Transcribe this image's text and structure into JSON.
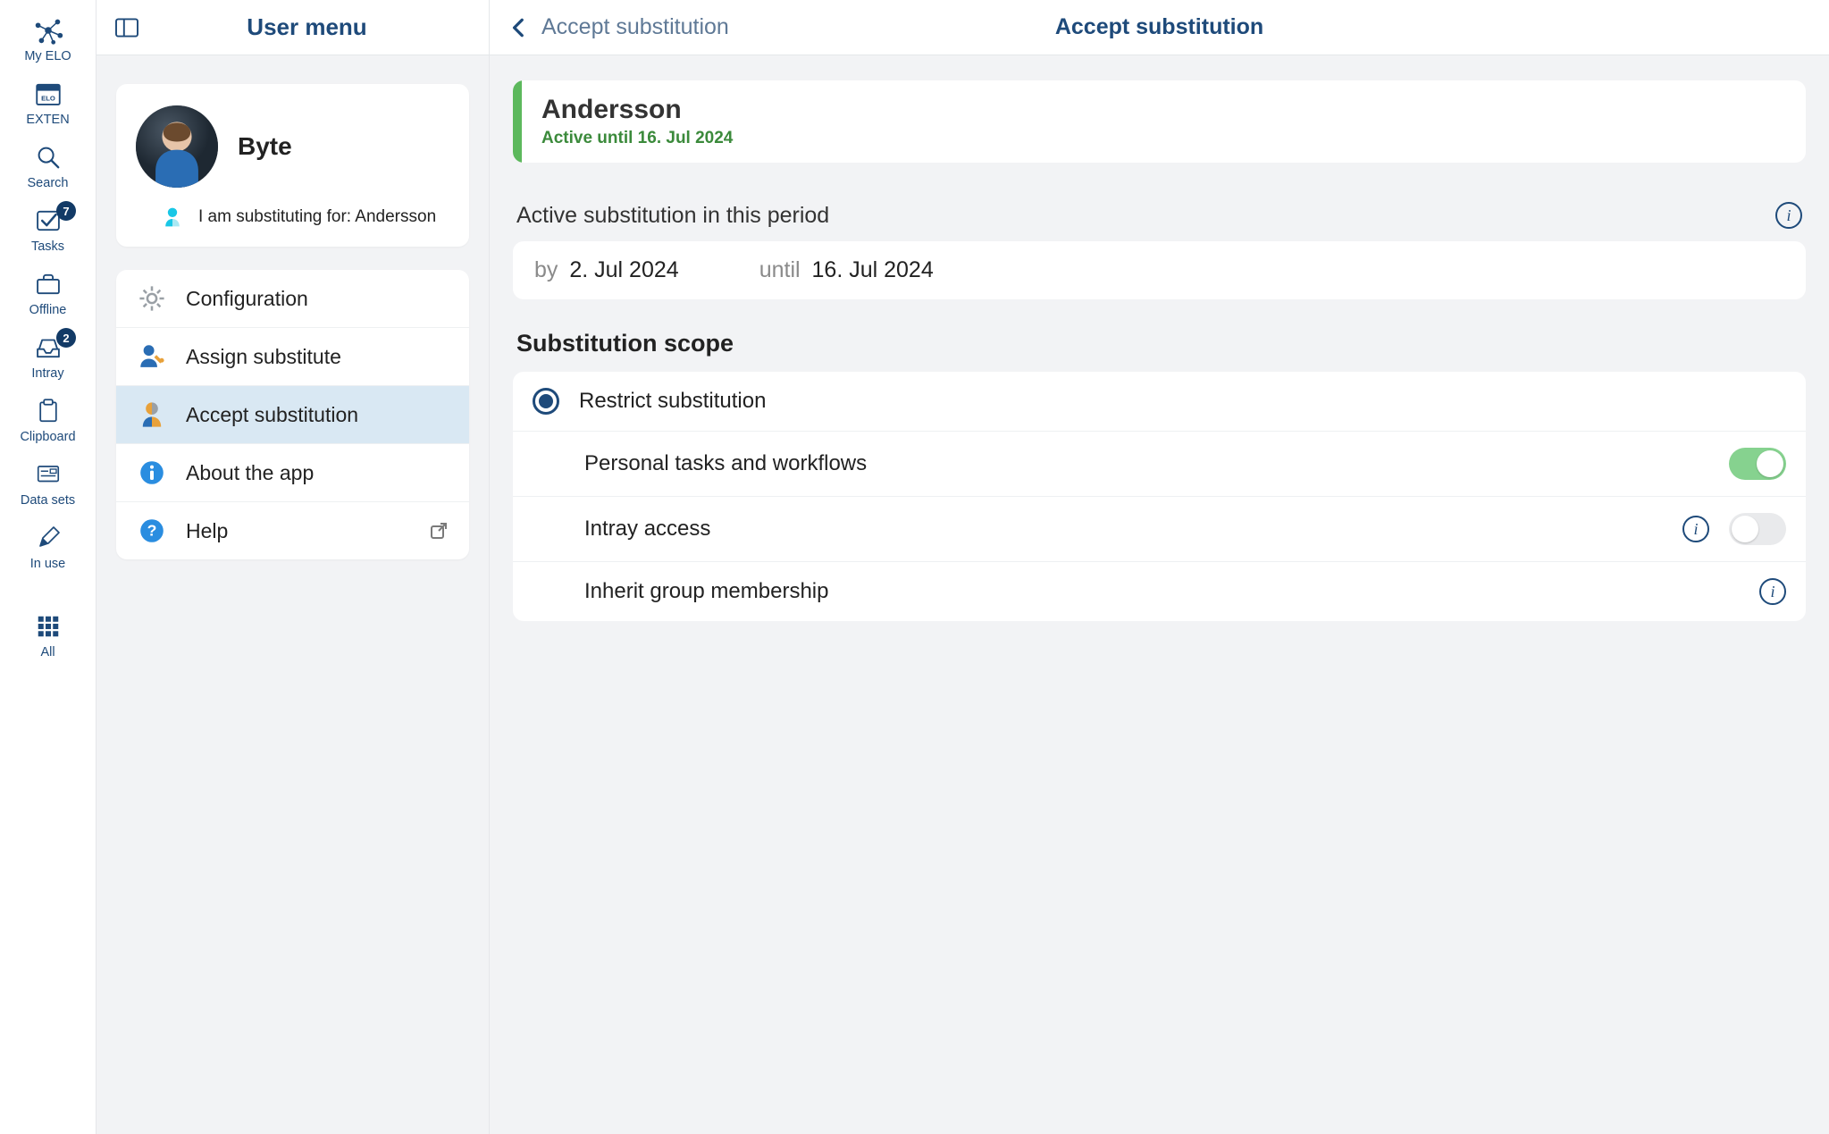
{
  "rail": {
    "items": [
      {
        "label": "My ELO",
        "icon": "network-icon"
      },
      {
        "label": "EXTEN",
        "icon": "calendar-icon"
      },
      {
        "label": "Search",
        "icon": "search-icon"
      },
      {
        "label": "Tasks",
        "icon": "check-icon",
        "badge": "7"
      },
      {
        "label": "Offline",
        "icon": "briefcase-icon"
      },
      {
        "label": "Intray",
        "icon": "tray-icon",
        "badge": "2"
      },
      {
        "label": "Clipboard",
        "icon": "clipboard-icon"
      },
      {
        "label": "Data sets",
        "icon": "form-icon"
      },
      {
        "label": "In use",
        "icon": "pencil-icon"
      }
    ],
    "all_label": "All",
    "all_icon": "grid-icon"
  },
  "menu": {
    "title": "User menu",
    "profile": {
      "name": "Byte",
      "substituting_label": "I am substituting for: Andersson"
    },
    "items": [
      {
        "label": "Configuration",
        "icon": "gear-icon"
      },
      {
        "label": "Assign substitute",
        "icon": "user-wrench-icon"
      },
      {
        "label": "Accept substitution",
        "icon": "user-split-icon",
        "active": true
      },
      {
        "label": "About the app",
        "icon": "info-solid-icon"
      },
      {
        "label": "Help",
        "icon": "question-solid-icon",
        "external": true
      }
    ]
  },
  "detail": {
    "breadcrumb_prev": "Accept substitution",
    "breadcrumb_current": "Accept substitution",
    "card": {
      "name": "Andersson",
      "status": "Active until 16. Jul 2024"
    },
    "period_heading": "Active substitution in this period",
    "period": {
      "from_label": "by",
      "from_value": "2. Jul 2024",
      "until_label": "until",
      "until_value": "16. Jul 2024"
    },
    "scope_heading": "Substitution scope",
    "scope": {
      "restrict_label": "Restrict substitution",
      "restrict_selected": true,
      "options": [
        {
          "label": "Personal tasks and workflows",
          "toggle": true,
          "info": false
        },
        {
          "label": "Intray access",
          "toggle": false,
          "info": true
        },
        {
          "label": "Inherit group membership",
          "toggle": null,
          "info": true
        }
      ]
    }
  }
}
